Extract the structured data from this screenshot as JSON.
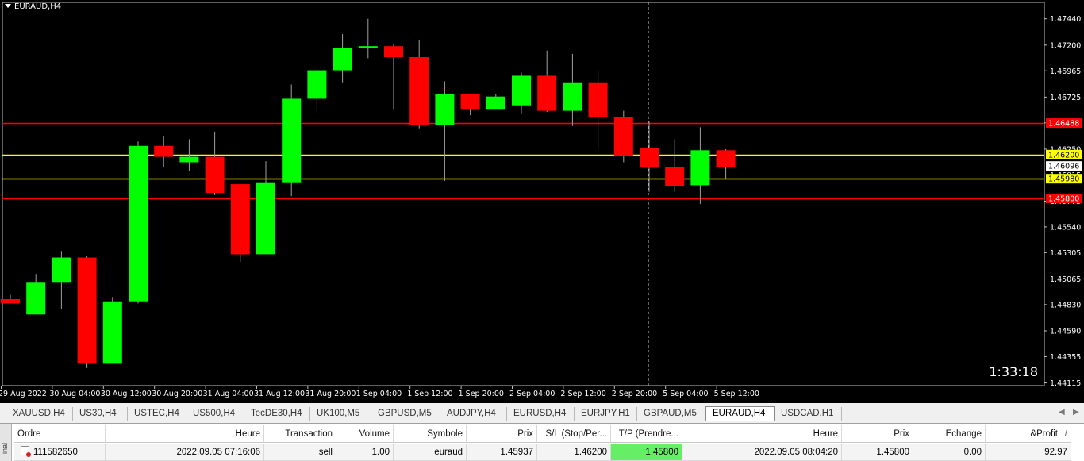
{
  "chart": {
    "title": "EURAUD,H4",
    "countdown": "1:33:18",
    "colors": {
      "background": "#000000",
      "bull": "#00ff00",
      "bear": "#ff0000",
      "wick": "#a0a0a0",
      "axis_text": "#ffffff",
      "resistance_line": "#ff0000",
      "order_line": "#ffff00"
    }
  },
  "chart_data": {
    "type": "candlestick",
    "symbol": "EURAUD",
    "timeframe": "H4",
    "ylim": [
      1.4409,
      1.4759
    ],
    "y_ticks": [
      "1.47440",
      "1.47200",
      "1.46965",
      "1.46725",
      "1.46490",
      "1.46250",
      "1.46015",
      "1.45775",
      "1.45540",
      "1.45305",
      "1.45065",
      "1.44830",
      "1.44590",
      "1.44355",
      "1.44115"
    ],
    "x_labels": [
      "29 Aug 2022",
      "30 Aug 04:00",
      "30 Aug 12:00",
      "30 Aug 20:00",
      "31 Aug 04:00",
      "31 Aug 12:00",
      "31 Aug 20:00",
      "1 Sep 04:00",
      "1 Sep 12:00",
      "1 Sep 20:00",
      "2 Sep 04:00",
      "2 Sep 12:00",
      "2 Sep 20:00",
      "5 Sep 04:00",
      "5 Sep 12:00"
    ],
    "candles": [
      {
        "o": 1.4488,
        "h": 1.4492,
        "l": 1.4484,
        "c": 1.4484
      },
      {
        "o": 1.4474,
        "h": 1.4511,
        "l": 1.4474,
        "c": 1.4503
      },
      {
        "o": 1.4503,
        "h": 1.4532,
        "l": 1.4479,
        "c": 1.4526
      },
      {
        "o": 1.4526,
        "h": 1.4527,
        "l": 1.4425,
        "c": 1.4429
      },
      {
        "o": 1.4429,
        "h": 1.449,
        "l": 1.4429,
        "c": 1.4486
      },
      {
        "o": 1.4486,
        "h": 1.4632,
        "l": 1.4484,
        "c": 1.4628
      },
      {
        "o": 1.4628,
        "h": 1.4637,
        "l": 1.4609,
        "c": 1.4618
      },
      {
        "o": 1.4613,
        "h": 1.4634,
        "l": 1.4605,
        "c": 1.4618
      },
      {
        "o": 1.4618,
        "h": 1.4641,
        "l": 1.4583,
        "c": 1.4585
      },
      {
        "o": 1.4593,
        "h": 1.4593,
        "l": 1.4522,
        "c": 1.4529
      },
      {
        "o": 1.4529,
        "h": 1.4614,
        "l": 1.4529,
        "c": 1.4594
      },
      {
        "o": 1.4594,
        "h": 1.4684,
        "l": 1.4582,
        "c": 1.4671
      },
      {
        "o": 1.4671,
        "h": 1.4699,
        "l": 1.466,
        "c": 1.4697
      },
      {
        "o": 1.4697,
        "h": 1.473,
        "l": 1.4686,
        "c": 1.4717
      },
      {
        "o": 1.4717,
        "h": 1.4744,
        "l": 1.4708,
        "c": 1.4719
      },
      {
        "o": 1.4719,
        "h": 1.4721,
        "l": 1.4661,
        "c": 1.4709
      },
      {
        "o": 1.4709,
        "h": 1.4725,
        "l": 1.4644,
        "c": 1.4647
      },
      {
        "o": 1.4647,
        "h": 1.4687,
        "l": 1.4596,
        "c": 1.4675
      },
      {
        "o": 1.4675,
        "h": 1.4675,
        "l": 1.4656,
        "c": 1.4661
      },
      {
        "o": 1.4661,
        "h": 1.4675,
        "l": 1.4661,
        "c": 1.4673
      },
      {
        "o": 1.4665,
        "h": 1.4695,
        "l": 1.4657,
        "c": 1.4692
      },
      {
        "o": 1.4692,
        "h": 1.4715,
        "l": 1.4659,
        "c": 1.466
      },
      {
        "o": 1.466,
        "h": 1.4712,
        "l": 1.4646,
        "c": 1.4686
      },
      {
        "o": 1.4686,
        "h": 1.4696,
        "l": 1.4625,
        "c": 1.4654
      },
      {
        "o": 1.4654,
        "h": 1.466,
        "l": 1.4613,
        "c": 1.4619
      },
      {
        "o": 1.4626,
        "h": 1.465,
        "l": 1.4586,
        "c": 1.4608
      },
      {
        "o": 1.4609,
        "h": 1.4634,
        "l": 1.4586,
        "c": 1.4591
      },
      {
        "o": 1.4592,
        "h": 1.4645,
        "l": 1.4575,
        "c": 1.4624
      },
      {
        "o": 1.4624,
        "h": 1.4625,
        "l": 1.4598,
        "c": 1.4609
      }
    ],
    "h_lines": [
      {
        "price": 1.46488,
        "label": "1.46488",
        "color": "#ff0000",
        "label_bg": "#ff0000",
        "label_fg": "#ffffff"
      },
      {
        "price": 1.462,
        "label": "1.46200",
        "color": "#ffff00",
        "label_bg": "#ffff00",
        "label_fg": "#000000"
      },
      {
        "price": 1.4598,
        "label": "1.45980",
        "color": "#ffff00",
        "label_bg": "#ffff00",
        "label_fg": "#000000"
      },
      {
        "price": 1.458,
        "label": "1.45800",
        "color": "#ff0000",
        "label_bg": "#ff0000",
        "label_fg": "#ffffff"
      }
    ],
    "current_price": {
      "price": 1.46096,
      "label": "1.46096",
      "label_bg": "#ffffff",
      "label_fg": "#000000"
    },
    "crosshair_candle_index": 25
  },
  "tabs": {
    "items": [
      "XAUUSD,H4",
      "US30,H4",
      "USTEC,H4",
      "US500,H4",
      "TecDE30,H4",
      "UK100,M5",
      "GBPUSD,M5",
      "AUDJPY,H4",
      "EURUSD,H4",
      "EURJPY,H1",
      "GBPAUD,M5",
      "EURAUD,H4",
      "USDCAD,H1"
    ],
    "active_index": 11
  },
  "terminal": {
    "side_label": "inal",
    "headers": [
      "Ordre",
      "Heure",
      "Transaction",
      "Volume",
      "Symbole",
      "Prix",
      "S/L (Stop/Per...",
      "T/P (Prendre...",
      "Heure",
      "Prix",
      "Echange",
      "&Profit"
    ],
    "sort_indicator": "/",
    "row": [
      "111582650",
      "2022.09.05 07:16:06",
      "sell",
      "1.00",
      "euraud",
      "1.45937",
      "1.46200",
      "1.45800",
      "2022.09.05 08:04:20",
      "1.45800",
      "0.00",
      "92.97"
    ]
  }
}
